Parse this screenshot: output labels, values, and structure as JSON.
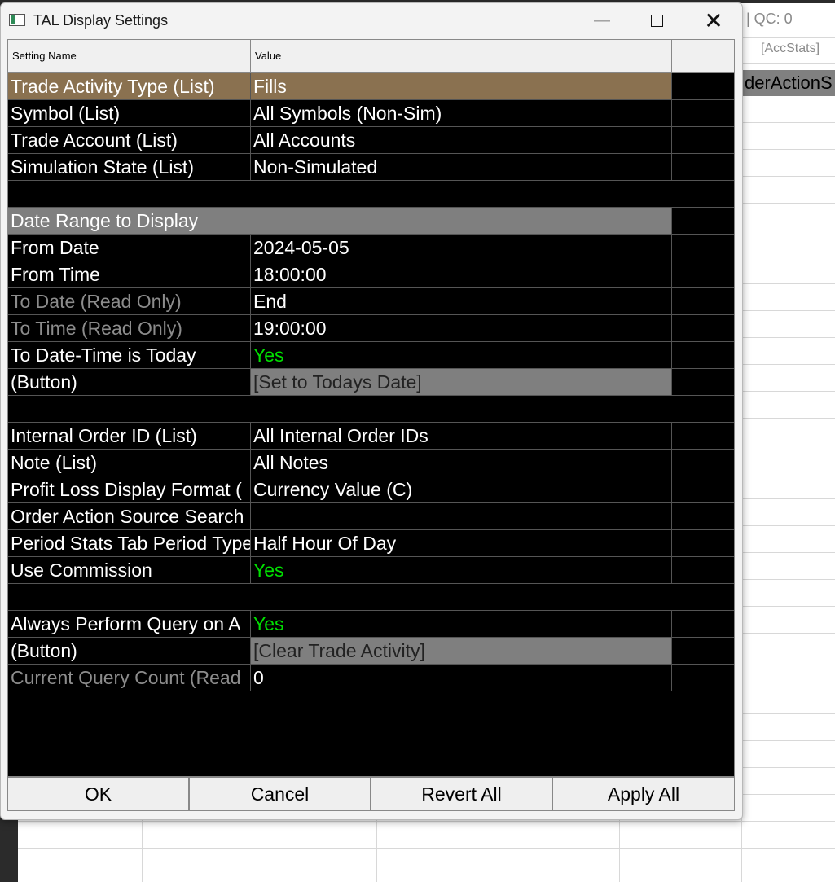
{
  "background": {
    "qc_label": "| QC: 0",
    "accstats_label": "[AccStats]",
    "order_action_label": "derActionS"
  },
  "window": {
    "title": "TAL Display Settings",
    "minimize": "—",
    "close": "✕"
  },
  "grid": {
    "headers": {
      "name": "Setting Name",
      "value": "Value",
      "extra": ""
    },
    "rows": [
      {
        "name": "Trade Activity Type (List)",
        "value": "Fills"
      },
      {
        "name": "Symbol (List)",
        "value": "All Symbols (Non-Sim)"
      },
      {
        "name": "Trade Account (List)",
        "value": "All Accounts"
      },
      {
        "name": "Simulation State (List)",
        "value": "Non-Simulated"
      },
      {
        "name": "",
        "value": ""
      },
      {
        "name": "Date Range to Display",
        "value": ""
      },
      {
        "name": "From Date",
        "value": "2024-05-05"
      },
      {
        "name": "From Time",
        "value": "18:00:00"
      },
      {
        "name": "To Date (Read Only)",
        "value": "End"
      },
      {
        "name": "To Time (Read Only)",
        "value": "19:00:00"
      },
      {
        "name": "To Date-Time is Today",
        "value": "Yes"
      },
      {
        "name": " (Button)",
        "value": "[Set to Todays Date]"
      },
      {
        "name": "",
        "value": ""
      },
      {
        "name": "Internal Order ID (List)",
        "value": "All Internal Order IDs"
      },
      {
        "name": "Note (List)",
        "value": "All Notes"
      },
      {
        "name": "Profit Loss Display Format (",
        "value": "Currency Value (C)"
      },
      {
        "name": "Order Action Source Search",
        "value": ""
      },
      {
        "name": "Period Stats Tab Period Type",
        "value": "Half Hour Of Day"
      },
      {
        "name": "Use Commission",
        "value": "Yes"
      },
      {
        "name": "",
        "value": ""
      },
      {
        "name": "Always Perform Query on A",
        "value": "Yes"
      },
      {
        "name": " (Button)",
        "value": "[Clear Trade Activity]"
      },
      {
        "name": "Current Query Count (Read",
        "value": "0"
      }
    ]
  },
  "buttons": {
    "ok": "OK",
    "cancel": "Cancel",
    "revert": "Revert All",
    "apply": "Apply All"
  },
  "colors": {
    "selected_row": "#8a7150",
    "section_row": "#7f7f7f",
    "yes_text": "#00e000",
    "readonly_text": "#8c8c8c"
  }
}
